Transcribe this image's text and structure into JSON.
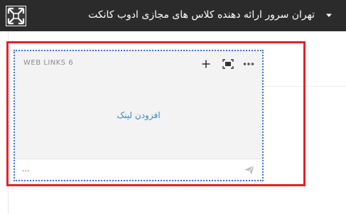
{
  "header": {
    "title": "تهران سرور ارائه دهنده کلاس های مجازی ادوب کانکت",
    "logo_icon": "app-logo-icon",
    "menu_icon": "chevron-down-icon"
  },
  "widget": {
    "name": "WEB LINKS 6",
    "add_link_label": "افزودن لینک",
    "footer_text": "...",
    "toolbar": {
      "add_icon": "plus-icon",
      "expand_icon": "maximize-icon",
      "more_icon": "more-dots-icon"
    },
    "footer_icon": "send-icon"
  },
  "colors": {
    "topbar_bg": "#2b2b2b",
    "highlight": "#e4202a",
    "selection_border": "#3a78d8",
    "link": "#3b86c6",
    "widget_bg": "#f3f3f3"
  }
}
